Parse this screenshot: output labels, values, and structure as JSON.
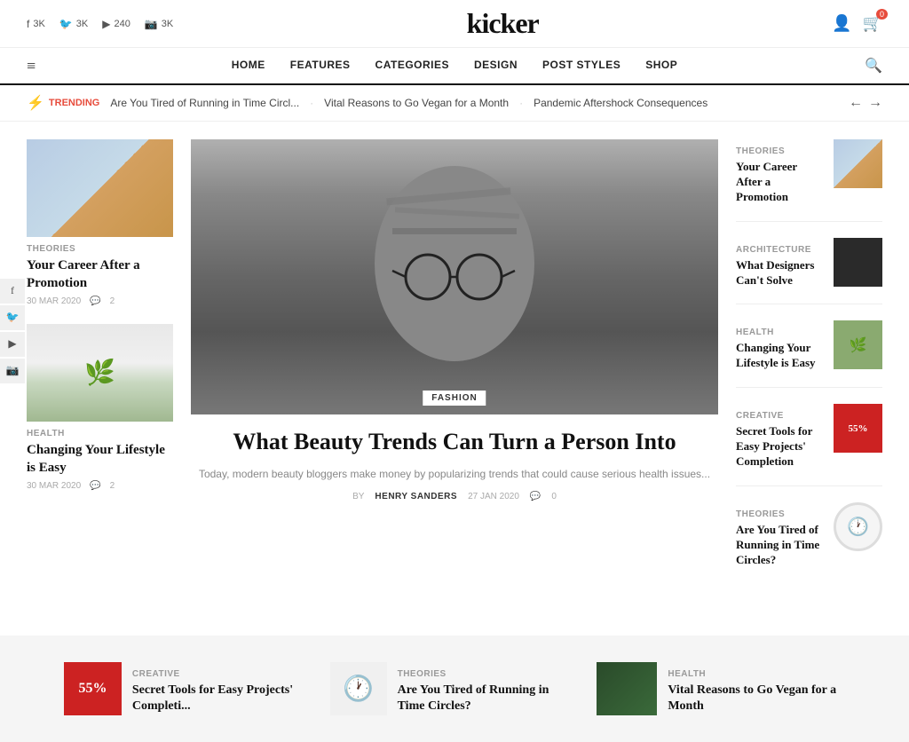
{
  "site": {
    "title": "kicker"
  },
  "top_social": {
    "items": [
      {
        "icon": "f",
        "count": "3K",
        "platform": "facebook"
      },
      {
        "icon": "🐦",
        "count": "3K",
        "platform": "twitter"
      },
      {
        "icon": "▶",
        "count": "240",
        "platform": "youtube"
      },
      {
        "icon": "📷",
        "count": "3K",
        "platform": "instagram"
      }
    ]
  },
  "top_right": {
    "cart_count": "0"
  },
  "nav": {
    "hamburger": "≡",
    "links": [
      "HOME",
      "FEATURES",
      "CATEGORIES",
      "DESIGN",
      "POST STYLES",
      "SHOP"
    ],
    "search_icon": "🔍"
  },
  "trending": {
    "label": "TRENDING",
    "items": [
      "Are You Tired of Running in Time Circl...",
      "Vital Reasons to Go Vegan for a Month",
      "Pandemic Aftershock Consequences"
    ]
  },
  "left_articles": [
    {
      "category": "THEORIES",
      "title": "Your Career After a Promotion",
      "date": "30 MAR 2020",
      "comments": "2"
    },
    {
      "category": "HEALTH",
      "title": "Changing Your Lifestyle is Easy",
      "date": "30 MAR 2020",
      "comments": "2"
    }
  ],
  "feature": {
    "category": "FASHION",
    "title": "What Beauty Trends Can Turn a Person Into",
    "excerpt": "Today, modern beauty bloggers make money by popularizing trends that could cause serious health issues...",
    "by": "BY",
    "author": "HENRY SANDERS",
    "date": "27 JAN 2020",
    "comments": "0"
  },
  "right_articles": [
    {
      "category": "THEORIES",
      "title": "Your Career After a Promotion",
      "img_type": "triangle"
    },
    {
      "category": "ARCHITECTURE",
      "title": "What Designers Can't Solve",
      "img_type": "dark"
    },
    {
      "category": "HEALTH",
      "title": "Changing Your Lifestyle is Easy",
      "img_type": "green"
    },
    {
      "category": "CREATIVE",
      "title": "Secret Tools for Easy Projects' Completion",
      "img_type": "red"
    },
    {
      "category": "THEORIES",
      "title": "Are You Tired of Running in Time Circles?",
      "img_type": "clock"
    }
  ],
  "social_float": [
    "f",
    "🐦",
    "▶",
    "📷"
  ],
  "bottom_articles": [
    {
      "category": "CREATIVE",
      "title": "Secret Tools for Easy Projects' Completi...",
      "img_type": "red"
    },
    {
      "category": "THEORIES",
      "title": "Are You Tired of Running in Time Circles?",
      "img_type": "clock"
    },
    {
      "category": "HEALTH",
      "title": "Vital Reasons to Go Vegan for a Month",
      "img_type": "dark-green"
    }
  ]
}
